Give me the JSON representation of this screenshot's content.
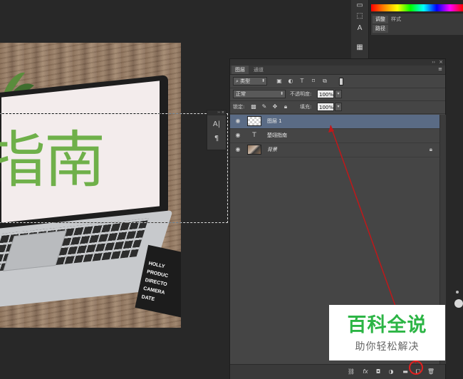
{
  "canvas": {
    "overlay_text": "指南",
    "clapper_lines": [
      "HOLLY",
      "PRODUC",
      "DIRECTO",
      "CAMERA",
      "DATE"
    ]
  },
  "adjust_panel": {
    "tabs": [
      "调整",
      "样式",
      "路径"
    ]
  },
  "char_panel": {
    "icons": [
      "character-icon",
      "paragraph-icon"
    ]
  },
  "layers_panel": {
    "tabs": [
      "图层",
      "通道"
    ],
    "filter_kind": "类型",
    "blend_mode": "正常",
    "opacity_label": "不透明度:",
    "opacity_value": "100%",
    "lock_label": "锁定:",
    "fill_label": "填充:",
    "fill_value": "100%",
    "layers": [
      {
        "name": "图层 1",
        "kind": "pixel",
        "selected": true
      },
      {
        "name": "楚翊指南",
        "kind": "text",
        "selected": false
      },
      {
        "name": "背景",
        "kind": "background",
        "selected": false,
        "locked": true
      }
    ],
    "bottom_icons": [
      "link-icon",
      "fx-icon",
      "mask-icon",
      "adjustment-icon",
      "folder-icon",
      "new-layer-icon",
      "trash-icon"
    ]
  },
  "colors": {
    "selected_layer": "#5a6b85",
    "annotation": "#c0181a",
    "watermark_green": "#2cb545"
  },
  "watermark": {
    "title": "百科全说",
    "subtitle": "助你轻松解决"
  }
}
